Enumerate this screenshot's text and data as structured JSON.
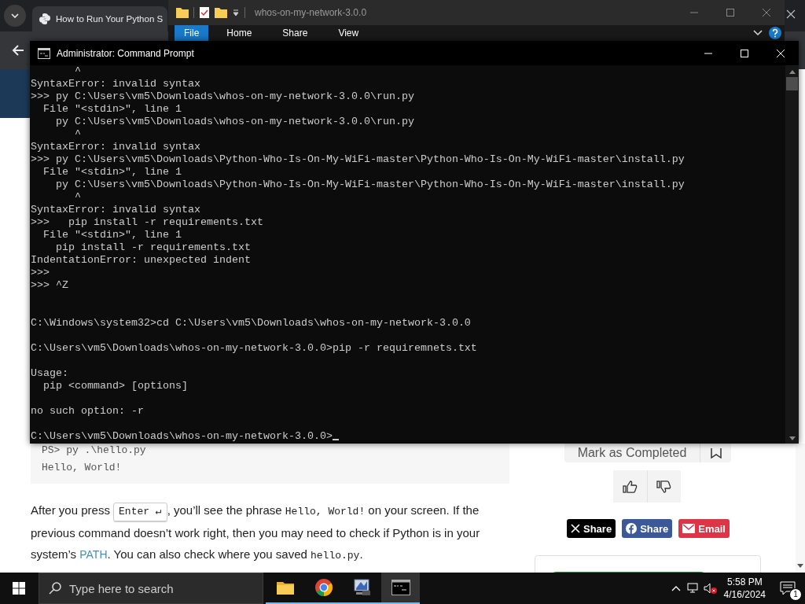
{
  "browser": {
    "tab_title": "How to Run Your Python S"
  },
  "explorer": {
    "title": "whos-on-my-network-3.0.0",
    "ribbon_tabs": [
      {
        "label": "File",
        "selected": true
      },
      {
        "label": "Home",
        "selected": false
      },
      {
        "label": "Share",
        "selected": false
      },
      {
        "label": "View",
        "selected": false
      }
    ]
  },
  "console": {
    "title": "Administrator: Command Prompt",
    "cursor": true,
    "blocks": [
      {
        "kind": "repl",
        "lines": [
          "       ^",
          "SyntaxError: invalid syntax",
          ">>> py C:\\Users\\vm5\\Downloads\\whos-on-my-network-3.0.0\\run.py",
          "  File \"<stdin>\", line 1",
          "    py C:\\Users\\vm5\\Downloads\\whos-on-my-network-3.0.0\\run.py",
          "       ^",
          "SyntaxError: invalid syntax",
          ">>> py C:\\Users\\vm5\\Downloads\\Python-Who-Is-On-My-WiFi-master\\Python-Who-Is-On-My-WiFi-master\\install.py",
          "  File \"<stdin>\", line 1",
          "    py C:\\Users\\vm5\\Downloads\\Python-Who-Is-On-My-WiFi-master\\Python-Who-Is-On-My-WiFi-master\\install.py",
          "       ^",
          "SyntaxError: invalid syntax",
          ">>>   pip install -r requirements.txt",
          "  File \"<stdin>\", line 1",
          "    pip install -r requirements.txt",
          "IndentationError: unexpected indent",
          ">>>",
          ">>> ^Z"
        ]
      },
      {
        "kind": "cmd",
        "lines": [
          "C:\\Windows\\system32>cd C:\\Users\\vm5\\Downloads\\whos-on-my-network-3.0.0"
        ]
      },
      {
        "kind": "cmd",
        "lines": [
          "C:\\Users\\vm5\\Downloads\\whos-on-my-network-3.0.0>pip -r requiremnets.txt"
        ]
      },
      {
        "kind": "cmd",
        "lines": [
          "Usage:",
          "  pip <command> [options]"
        ]
      },
      {
        "kind": "cmd",
        "lines": [
          "no such option: -r"
        ]
      },
      {
        "kind": "cmd",
        "lines": [
          "C:\\Users\\vm5\\Downloads\\whos-on-my-network-3.0.0>"
        ]
      }
    ]
  },
  "article": {
    "code_lines": [
      "PS> py .\\hello.py",
      "Hello, World!"
    ],
    "paragraph": [
      {
        "kind": "text",
        "text": "After you press "
      },
      {
        "kind": "key",
        "text": "Enter ↵"
      },
      {
        "kind": "text",
        "text": ", you’ll see the phrase "
      },
      {
        "kind": "code",
        "text": "Hello, World!"
      },
      {
        "kind": "text",
        "text": " on your screen. If the previous command doesn’t work right, then you may need to check if Python is in your system’s "
      },
      {
        "kind": "link",
        "text": "PATH"
      },
      {
        "kind": "text",
        "text": ". You can also check where you saved "
      },
      {
        "kind": "code",
        "text": "hello.py"
      },
      {
        "kind": "text",
        "text": "."
      }
    ]
  },
  "sidebar": {
    "complete_button": "Mark as Completed",
    "share_buttons": [
      {
        "kind": "x",
        "label": "Share"
      },
      {
        "kind": "facebook",
        "label": "Share"
      },
      {
        "kind": "email",
        "label": "Email"
      }
    ]
  },
  "taskbar": {
    "search_placeholder": "Type here to search",
    "apps": [
      {
        "kind": "folder",
        "selected": false
      },
      {
        "kind": "chrome",
        "selected": false
      },
      {
        "kind": "network",
        "selected": false
      },
      {
        "kind": "terminal",
        "selected": true
      }
    ],
    "time": "5:58 PM",
    "date": "4/16/2024",
    "notification_count": "1"
  }
}
